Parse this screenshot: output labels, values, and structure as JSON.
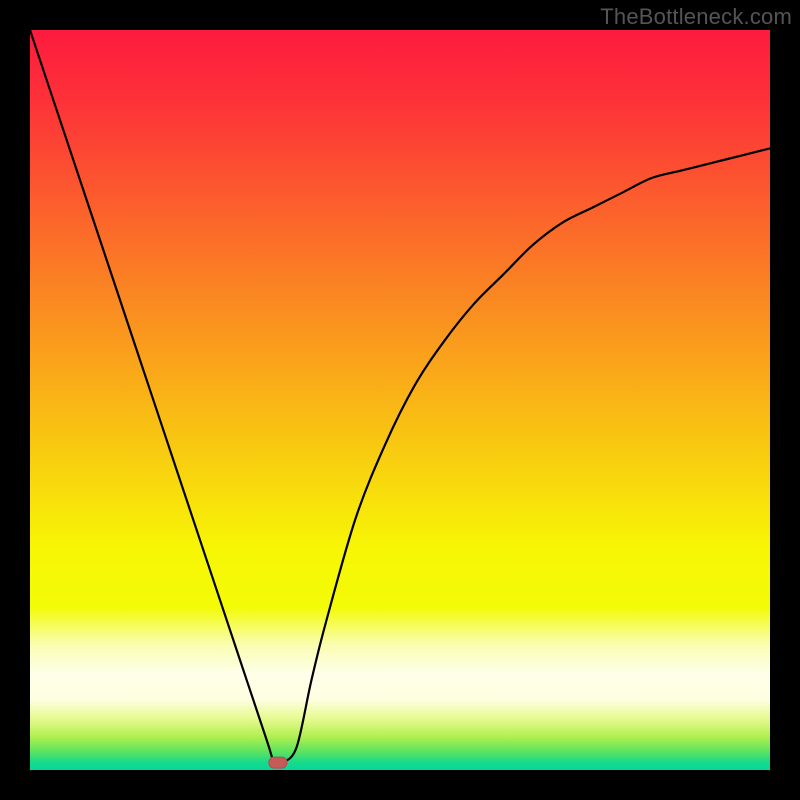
{
  "watermark": "TheBottleneck.com",
  "colors": {
    "frame": "#000000",
    "gradient_stops": [
      {
        "offset": 0.0,
        "color": "#fd1b3f"
      },
      {
        "offset": 0.1,
        "color": "#fd3338"
      },
      {
        "offset": 0.2,
        "color": "#fc5330"
      },
      {
        "offset": 0.3,
        "color": "#fb7427"
      },
      {
        "offset": 0.4,
        "color": "#fa941f"
      },
      {
        "offset": 0.5,
        "color": "#f9b516"
      },
      {
        "offset": 0.6,
        "color": "#f8d50e"
      },
      {
        "offset": 0.7,
        "color": "#f7f605"
      },
      {
        "offset": 0.78,
        "color": "#f3fb07"
      },
      {
        "offset": 0.83,
        "color": "#fafdb0"
      },
      {
        "offset": 0.87,
        "color": "#feffe8"
      },
      {
        "offset": 0.905,
        "color": "#feffe0"
      },
      {
        "offset": 0.93,
        "color": "#e7fa92"
      },
      {
        "offset": 0.955,
        "color": "#b0f04f"
      },
      {
        "offset": 0.975,
        "color": "#5de35f"
      },
      {
        "offset": 0.99,
        "color": "#15da8d"
      },
      {
        "offset": 1.0,
        "color": "#07d89b"
      }
    ],
    "curve": "#000000",
    "marker_fill": "#c65a58",
    "marker_stroke": "#b24d4a"
  },
  "chart_data": {
    "type": "line",
    "title": "",
    "xlabel": "",
    "ylabel": "",
    "xlim": [
      0,
      100
    ],
    "ylim": [
      0,
      100
    ],
    "series": [
      {
        "name": "bottleneck-curve",
        "x": [
          0,
          4,
          8,
          12,
          16,
          20,
          24,
          28,
          32,
          33,
          34,
          36,
          38,
          40,
          44,
          48,
          52,
          56,
          60,
          64,
          68,
          72,
          76,
          80,
          84,
          88,
          92,
          96,
          100
        ],
        "y": [
          100,
          88,
          76,
          64,
          52,
          40,
          28,
          16,
          4,
          1,
          1,
          3,
          12,
          20,
          34,
          44,
          52,
          58,
          63,
          67,
          71,
          74,
          76,
          78,
          80,
          81,
          82,
          83,
          84
        ]
      }
    ],
    "annotations": [
      {
        "name": "optimum-marker",
        "x": 33.5,
        "y": 1
      }
    ],
    "watermark": "TheBottleneck.com"
  }
}
